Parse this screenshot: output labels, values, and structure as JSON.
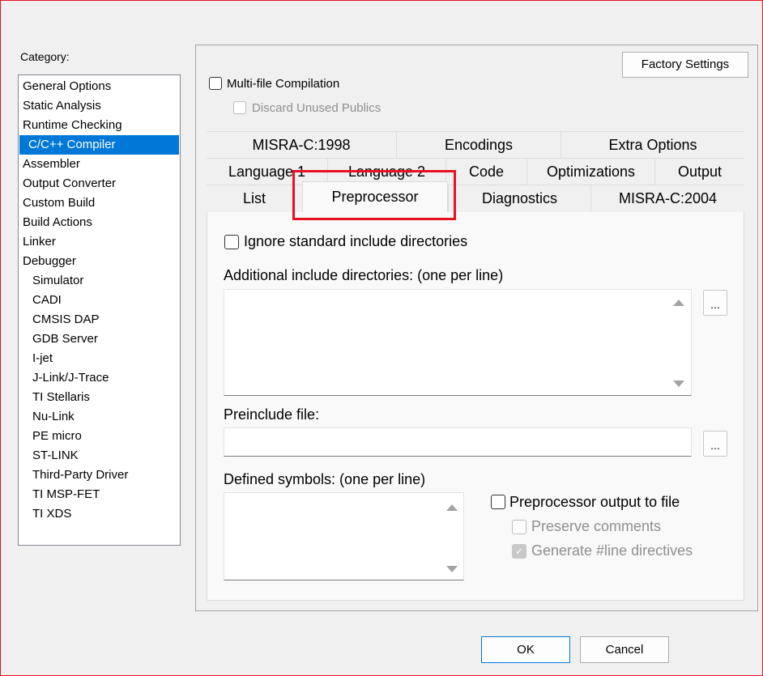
{
  "category": {
    "label": "Category:",
    "items": [
      {
        "label": "General Options"
      },
      {
        "label": "Static Analysis"
      },
      {
        "label": "Runtime Checking"
      },
      {
        "label": "C/C++ Compiler",
        "selected": true
      },
      {
        "label": "Assembler"
      },
      {
        "label": "Output Converter"
      },
      {
        "label": "Custom Build"
      },
      {
        "label": "Build Actions"
      },
      {
        "label": "Linker"
      },
      {
        "label": "Debugger"
      },
      {
        "label": "Simulator",
        "sub": true
      },
      {
        "label": "CADI",
        "sub": true
      },
      {
        "label": "CMSIS DAP",
        "sub": true
      },
      {
        "label": "GDB Server",
        "sub": true
      },
      {
        "label": "I-jet",
        "sub": true
      },
      {
        "label": "J-Link/J-Trace",
        "sub": true
      },
      {
        "label": "TI Stellaris",
        "sub": true
      },
      {
        "label": "Nu-Link",
        "sub": true
      },
      {
        "label": "PE micro",
        "sub": true
      },
      {
        "label": "ST-LINK",
        "sub": true
      },
      {
        "label": "Third-Party Driver",
        "sub": true
      },
      {
        "label": "TI MSP-FET",
        "sub": true
      },
      {
        "label": "TI XDS",
        "sub": true
      }
    ]
  },
  "options": {
    "factory_settings": "Factory Settings",
    "multi_file": {
      "label": "Multi-file Compilation",
      "checked": false
    },
    "discard_unused": {
      "label": "Discard Unused Publics",
      "checked": false,
      "enabled": false
    }
  },
  "tabs": {
    "row1": [
      "MISRA-C:1998",
      "Encodings",
      "Extra Options"
    ],
    "row2": [
      "Language 1",
      "Language 2",
      "Code",
      "Optimizations",
      "Output"
    ],
    "row3": [
      "List",
      "Preprocessor",
      "Diagnostics",
      "MISRA-C:2004"
    ],
    "active": "Preprocessor"
  },
  "preprocessor": {
    "ignore_std": {
      "label": "Ignore standard include directories",
      "checked": false
    },
    "additional_include_label": "Additional include directories: (one per line)",
    "additional_include_value": "",
    "preinclude_label": "Preinclude file:",
    "preinclude_value": "",
    "defined_symbols_label": "Defined symbols: (one per line)",
    "defined_symbols_value": "",
    "browse_label": "...",
    "output_to_file": {
      "label": "Preprocessor output to file",
      "checked": false
    },
    "preserve_comments": {
      "label": "Preserve comments",
      "checked": false,
      "enabled": false
    },
    "generate_line": {
      "label": "Generate #line directives",
      "checked": true,
      "enabled": false
    }
  },
  "buttons": {
    "ok": "OK",
    "cancel": "Cancel"
  },
  "colors": {
    "selection": "#0078d7",
    "highlight": "#e81123"
  }
}
